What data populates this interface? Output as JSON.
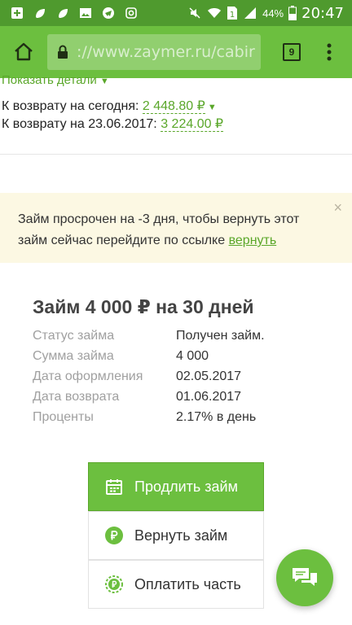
{
  "status_bar": {
    "battery_percent": "44%",
    "time": "20:47",
    "sim_number": "1"
  },
  "browser": {
    "url_prefix": "://www.zaymer.ru/",
    "url_rest": "cabir",
    "tab_count": "9"
  },
  "summary": {
    "show_details": "Показать детали",
    "today_label": "К возврату на сегодня:",
    "today_amount": "2 448.80 ₽",
    "date_label": "К возврату на 23.06.2017:",
    "date_amount": "3 224.00 ₽"
  },
  "alert": {
    "message": "Займ просрочен на -3 дня, чтобы вернуть этот займ сейчас перейдите по ссылке",
    "link_text": "вернуть",
    "close": "×"
  },
  "loan": {
    "title": "Займ 4 000 ₽ на 30 дней",
    "rows": [
      {
        "label": "Статус займа",
        "value": "Получен займ."
      },
      {
        "label": "Сумма займа",
        "value": "4 000"
      },
      {
        "label": "Дата оформления",
        "value": "02.05.2017"
      },
      {
        "label": "Дата возврата",
        "value": "01.06.2017"
      },
      {
        "label": "Проценты",
        "value": "2.17% в день"
      }
    ]
  },
  "actions": {
    "extend": "Продлить займ",
    "repay": "Вернуть займ",
    "pay_part": "Оплатить часть"
  },
  "colors": {
    "status_bar": "#4f9a2e",
    "toolbar": "#6cbf3f",
    "accent": "#5aa72a",
    "alert_bg": "#fcf8e3"
  }
}
